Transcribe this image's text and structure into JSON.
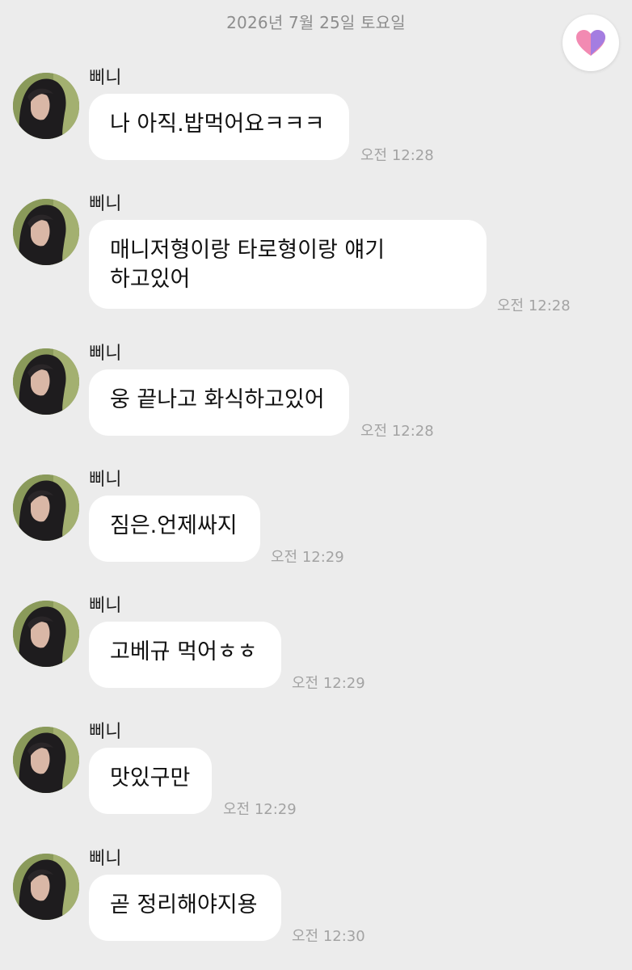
{
  "header": {
    "date": "2026년 7월 25일 토요일"
  },
  "icons": {
    "favorite": "heart-icon",
    "avatar": "profile-photo"
  },
  "colors": {
    "background": "#ececec",
    "bubble": "#ffffff",
    "heart_pink": "#f28ab2",
    "heart_purple": "#9b7be6"
  },
  "messages": [
    {
      "sender": "삐니",
      "text": "나 아직.밥먹어요ㅋㅋㅋ",
      "time": "오전 12:28"
    },
    {
      "sender": "삐니",
      "text": "매니저형이랑 타로형이랑 얘기\n하고있어",
      "time": "오전 12:28"
    },
    {
      "sender": "삐니",
      "text": "웅 끝나고 화식하고있어",
      "time": "오전 12:28"
    },
    {
      "sender": "삐니",
      "text": "짐은.언제싸지",
      "time": "오전 12:29"
    },
    {
      "sender": "삐니",
      "text": "고베규 먹어ㅎㅎ",
      "time": "오전 12:29"
    },
    {
      "sender": "삐니",
      "text": "맛있구만",
      "time": "오전 12:29"
    },
    {
      "sender": "삐니",
      "text": "곧 정리해야지용",
      "time": "오전 12:30"
    }
  ]
}
